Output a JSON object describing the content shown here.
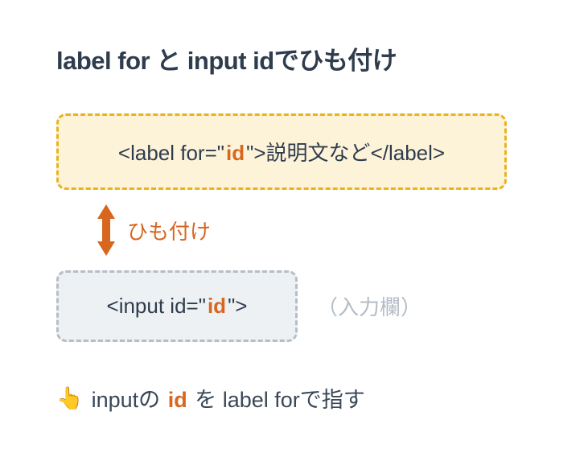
{
  "heading": "label for と input idでひも付け",
  "label_box": {
    "open_tag_before_id": "<label for=\"",
    "id_text": "id",
    "open_tag_after_id": "\">",
    "inner_text": "説明文など",
    "close_tag": "</label>"
  },
  "link": {
    "text": "ひも付け"
  },
  "input_box": {
    "tag_before_id": "<input id=\"",
    "id_text": "id",
    "tag_after_id": "\">"
  },
  "input_note": "（入力欄）",
  "footer": {
    "emoji": "👆",
    "before_id": "inputの",
    "id_text": "id",
    "after_id": " を label forで指す"
  },
  "colors": {
    "orange": "#d8661f",
    "label_box_border": "#e9b21e",
    "label_box_bg": "#fdf3d9",
    "input_box_border": "#b5bec7",
    "input_box_bg": "#eef1f3",
    "text": "#2f3c4d"
  }
}
